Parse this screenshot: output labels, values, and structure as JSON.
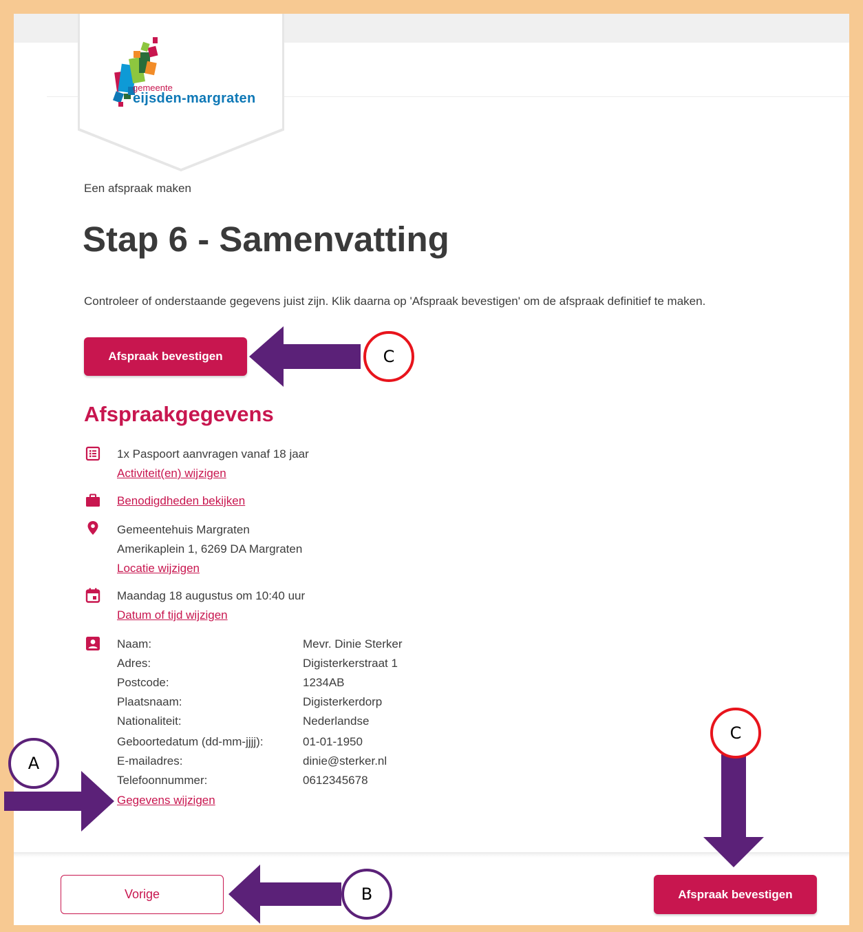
{
  "brand": {
    "logo_line1": "gemeente",
    "logo_line2": "eijsden-margraten",
    "accent": "#c8164f",
    "blue": "#0e78b6"
  },
  "breadcrumb": "Een afspraak maken",
  "title": "Stap 6 - Samenvatting",
  "intro": "Controleer of onderstaande gegevens juist zijn. Klik daarna op 'Afspraak bevestigen' om de afspraak definitief te maken.",
  "confirm_label": "Afspraak bevestigen",
  "section_title": "Afspraakgegevens",
  "activity": {
    "text": "1x Paspoort aanvragen vanaf 18 jaar",
    "link": "Activiteit(en) wijzigen",
    "icon": "list-icon"
  },
  "requirements": {
    "link": "Benodigdheden bekijken",
    "icon": "briefcase-icon"
  },
  "location": {
    "name": "Gemeentehuis Margraten",
    "address": "Amerikaplein 1, 6269 DA Margraten",
    "link": "Locatie wijzigen",
    "icon": "map-pin-icon"
  },
  "datetime": {
    "text": "Maandag 18 augustus om 10:40 uur",
    "link": "Datum of tijd wijzigen",
    "icon": "calendar-icon"
  },
  "personal": {
    "icon": "contact-card-icon",
    "fields": [
      {
        "label": "Naam:",
        "value": "Mevr. Dinie Sterker"
      },
      {
        "label": "Adres:",
        "value": "Digisterkerstraat 1"
      },
      {
        "label": "Postcode:",
        "value": "1234AB"
      },
      {
        "label": "Plaatsnaam:",
        "value": "Digisterkerdorp"
      },
      {
        "label": "Nationaliteit:",
        "value": "Nederlandse"
      },
      {
        "label": "Geboortedatum (dd-mm-jjjj):",
        "value": "01-01-1950"
      },
      {
        "label": "E-mailadres:",
        "value": "dinie@sterker.nl"
      },
      {
        "label": "Telefoonnummer:",
        "value": "0612345678"
      }
    ],
    "link": "Gegevens wijzigen"
  },
  "footer": {
    "prev_label": "Vorige",
    "confirm_label": "Afspraak bevestigen"
  },
  "annotations": {
    "a": "A",
    "b": "B",
    "c_top": "C",
    "c_bottom": "C",
    "arrow_color": "#5b2178",
    "circle_red": "#e8141c"
  }
}
